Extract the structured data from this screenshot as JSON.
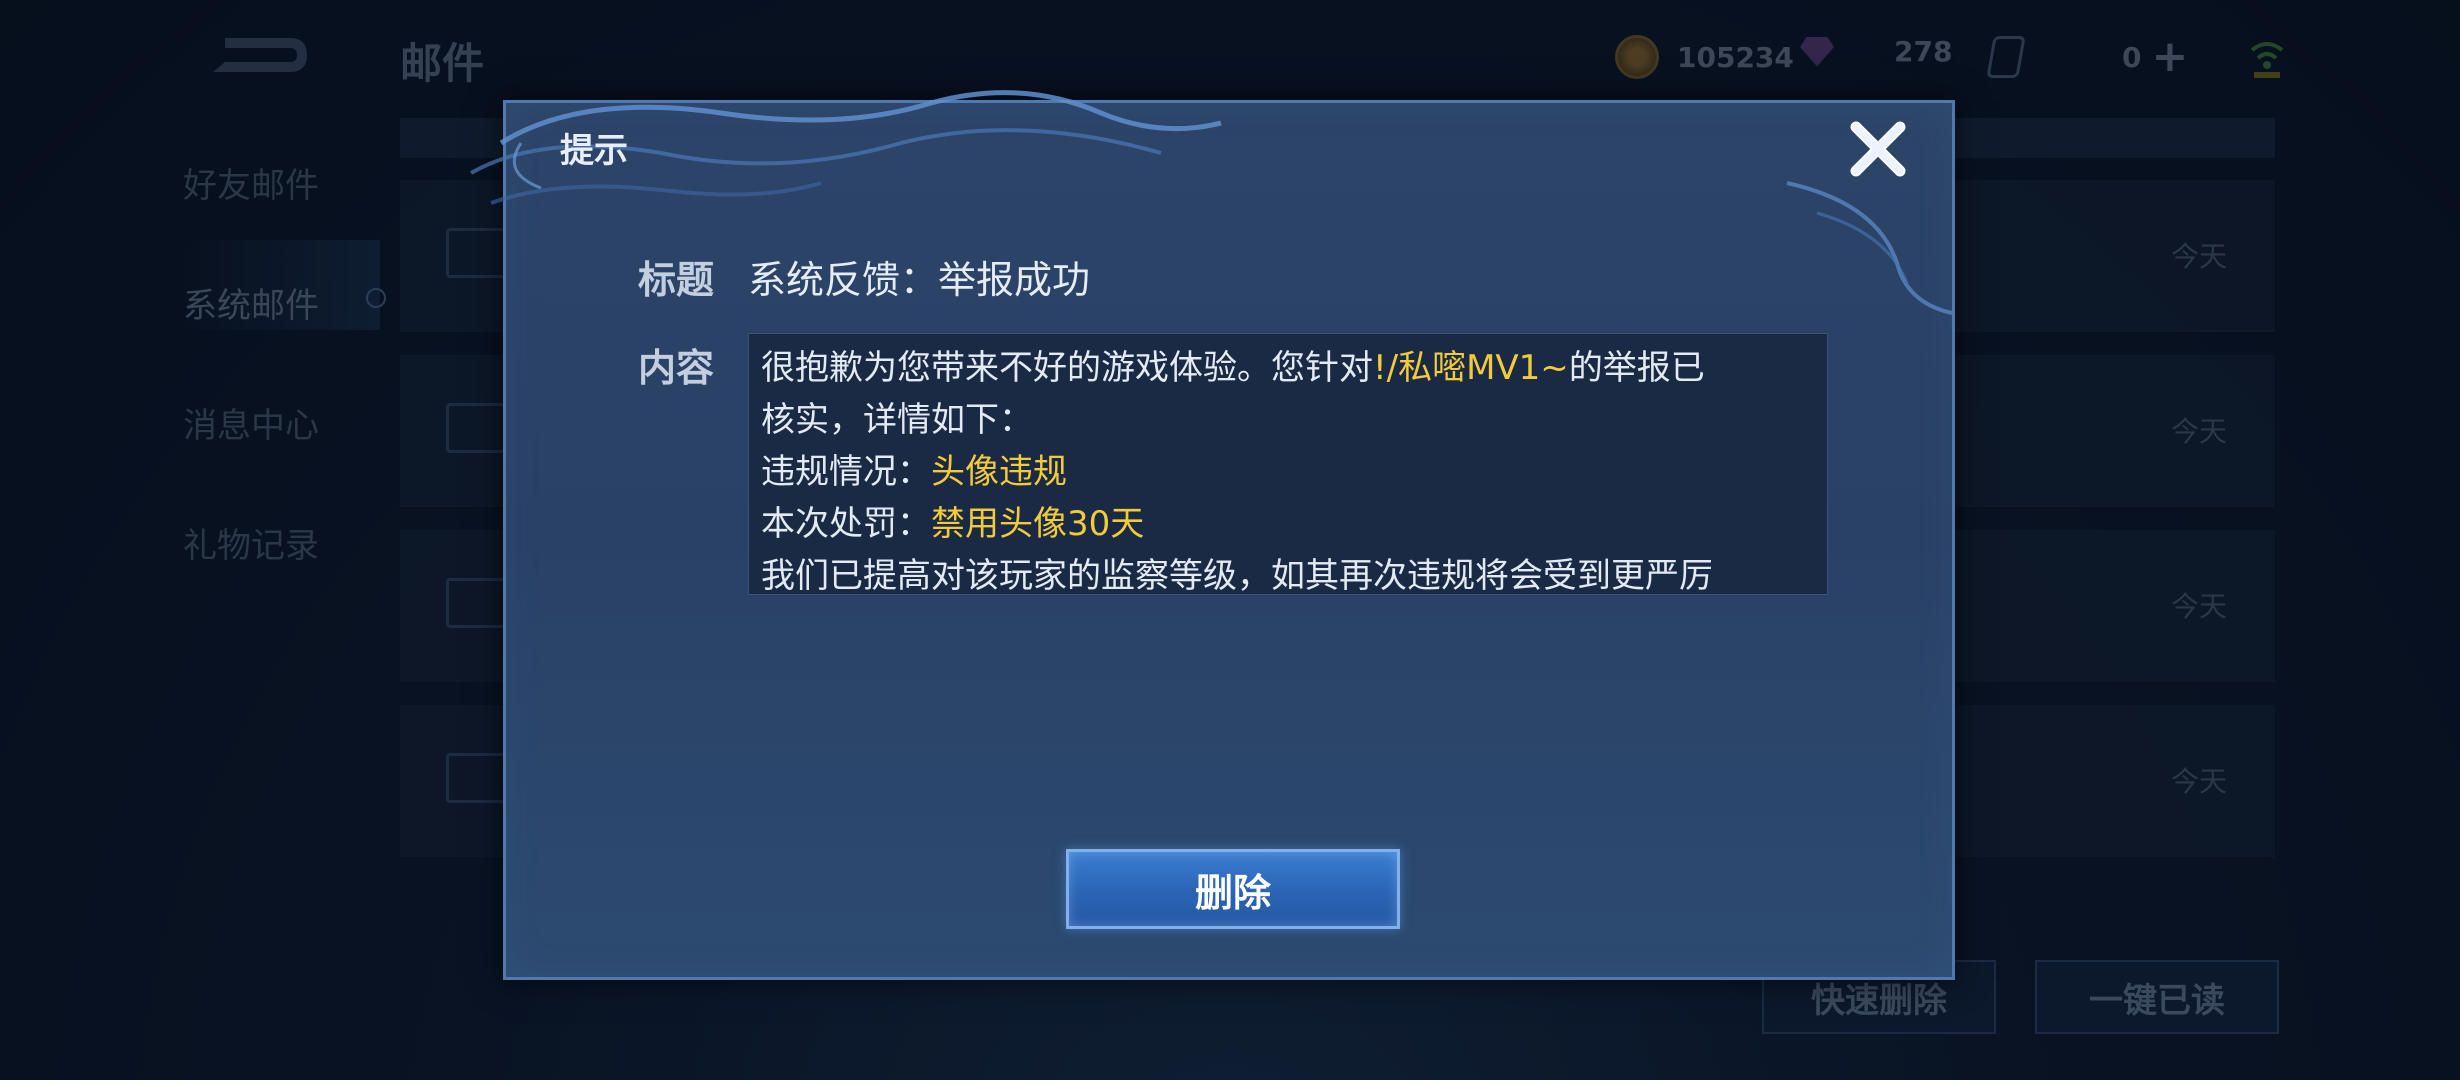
{
  "header": {
    "title": "邮件",
    "coins": "105234",
    "gems": "278",
    "tickets": "0"
  },
  "sidebar": {
    "items": [
      {
        "label": "好友邮件"
      },
      {
        "label": "系统邮件"
      },
      {
        "label": "消息中心"
      },
      {
        "label": "礼物记录"
      }
    ],
    "active_index": 1
  },
  "mail_list": {
    "rows": [
      {
        "date": "今天"
      },
      {
        "date": "今天"
      },
      {
        "date": "今天"
      },
      {
        "date": "今天"
      }
    ]
  },
  "footer": {
    "quick_delete_label": "快速删除",
    "read_all_label": "一键已读"
  },
  "dialog": {
    "title": "提示",
    "subject_label": "标题",
    "subject": "系统反馈：举报成功",
    "content_label": "内容",
    "content": {
      "line1_prefix": "很抱歉为您带来不好的游戏体验。您针对",
      "player_name": "!/私嘧MV1~",
      "line1_suffix": "的举报已",
      "line2": "核实，详情如下：",
      "violation_label": "违规情况：",
      "violation_value": "头像违规",
      "penalty_label": "本次处罚：",
      "penalty_value": "禁用头像30天",
      "line5": "我们已提高对该玩家的监察等级，如其再次违规将会受到更严厉"
    },
    "delete_label": "删除"
  },
  "colors": {
    "highlight": "#f2cb3a",
    "dialog_bg": "#2c4468",
    "button_blue": "#3a7dd0"
  }
}
